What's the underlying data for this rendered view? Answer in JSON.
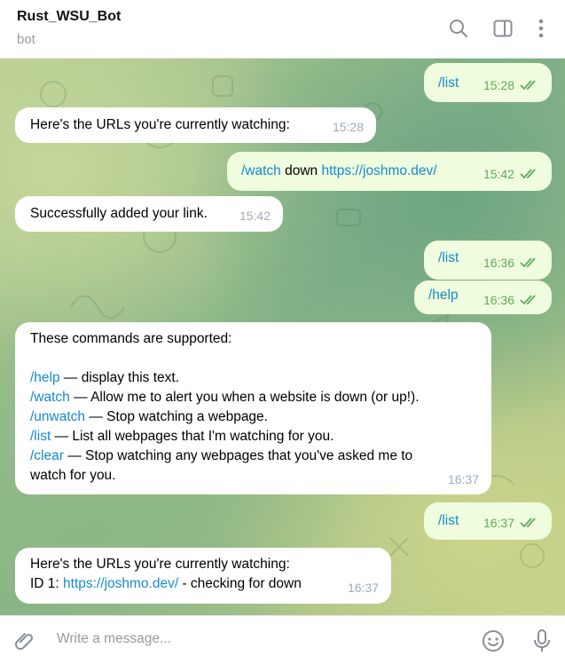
{
  "header": {
    "title": "Rust_WSU_Bot",
    "subtitle": "bot",
    "icons": [
      "search-icon",
      "sidebar-toggle-icon",
      "more-vertical-icon"
    ]
  },
  "messages": [
    {
      "dir": "out",
      "parts": [
        {
          "t": "/list",
          "link": true
        }
      ],
      "time": "15:28",
      "read": true
    },
    {
      "dir": "in",
      "lines": [
        "Here's the URLs you're currently watching:"
      ],
      "time": "15:28"
    },
    {
      "dir": "out",
      "parts": [
        {
          "t": "/watch",
          "link": true
        },
        {
          "t": " down ",
          "link": false
        },
        {
          "t": "https://joshmo.dev/",
          "link": true
        }
      ],
      "time": "15:42",
      "read": true
    },
    {
      "dir": "in",
      "lines": [
        "Successfully added your link."
      ],
      "time": "15:42"
    },
    {
      "dir": "out",
      "parts": [
        {
          "t": "/list",
          "link": true
        }
      ],
      "time": "16:36",
      "read": true
    },
    {
      "dir": "out",
      "parts": [
        {
          "t": "/help",
          "link": true
        }
      ],
      "time": "16:36",
      "read": true
    },
    {
      "dir": "in",
      "intro": "These commands are supported:",
      "commands": [
        {
          "cmd": "/help",
          "desc": " — display this text."
        },
        {
          "cmd": "/watch",
          "desc": " — Allow me to alert you when a website is down (or up!)."
        },
        {
          "cmd": "/unwatch",
          "desc": " — Stop watching a webpage."
        },
        {
          "cmd": "/list",
          "desc": " — List all webpages that I'm watching for you."
        },
        {
          "cmd": "/clear",
          "desc": " — Stop watching any webpages that you've asked me to"
        }
      ],
      "tail": "watch for you.",
      "time": "16:37"
    },
    {
      "dir": "out",
      "parts": [
        {
          "t": "/list",
          "link": true
        }
      ],
      "time": "16:37",
      "read": true
    },
    {
      "dir": "in",
      "line1": "Here's the URLs you're currently watching:",
      "prefix": "ID 1: ",
      "url": "https://joshmo.dev/",
      "suffix": " - checking for down",
      "time": "16:37"
    }
  ],
  "composer": {
    "placeholder": "Write a message...",
    "icons": [
      "attach-icon",
      "emoji-icon",
      "microphone-icon"
    ]
  }
}
